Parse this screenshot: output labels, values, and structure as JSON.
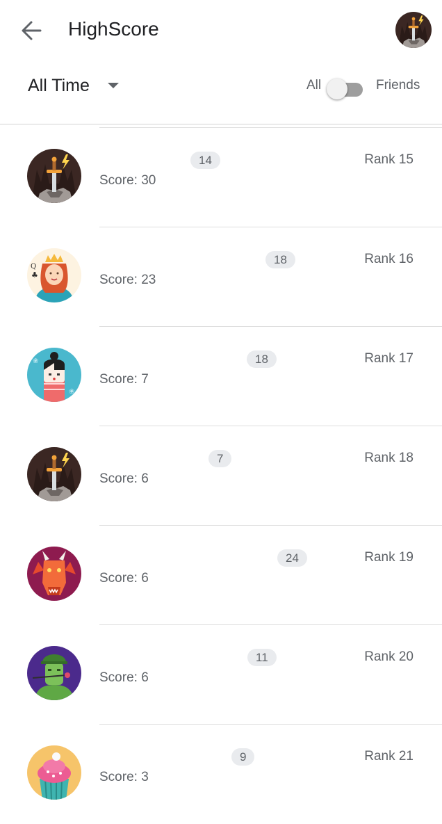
{
  "header": {
    "title": "HighScore",
    "back_icon": "arrow-left-icon"
  },
  "filters": {
    "period": "All Time",
    "toggle": {
      "left_label": "All",
      "right_label": "Friends",
      "on": false
    }
  },
  "leaderboard": [
    {
      "avatar": "sword-stone",
      "chip": "14",
      "score": "Score: 30",
      "rank": "Rank 15"
    },
    {
      "avatar": "queen-card",
      "chip": "18",
      "score": "Score: 23",
      "rank": "Rank 16"
    },
    {
      "avatar": "kokeshi-doll",
      "chip": "18",
      "score": "Score: 7",
      "rank": "Rank 17"
    },
    {
      "avatar": "sword-stone",
      "chip": "7",
      "score": "Score: 6",
      "rank": "Rank 18"
    },
    {
      "avatar": "red-dragon",
      "chip": "24",
      "score": "Score: 6",
      "rank": "Rank 19"
    },
    {
      "avatar": "green-soldier",
      "chip": "11",
      "score": "Score: 6",
      "rank": "Rank 20"
    },
    {
      "avatar": "cupcake",
      "chip": "9",
      "score": "Score: 3",
      "rank": "Rank 21"
    }
  ]
}
